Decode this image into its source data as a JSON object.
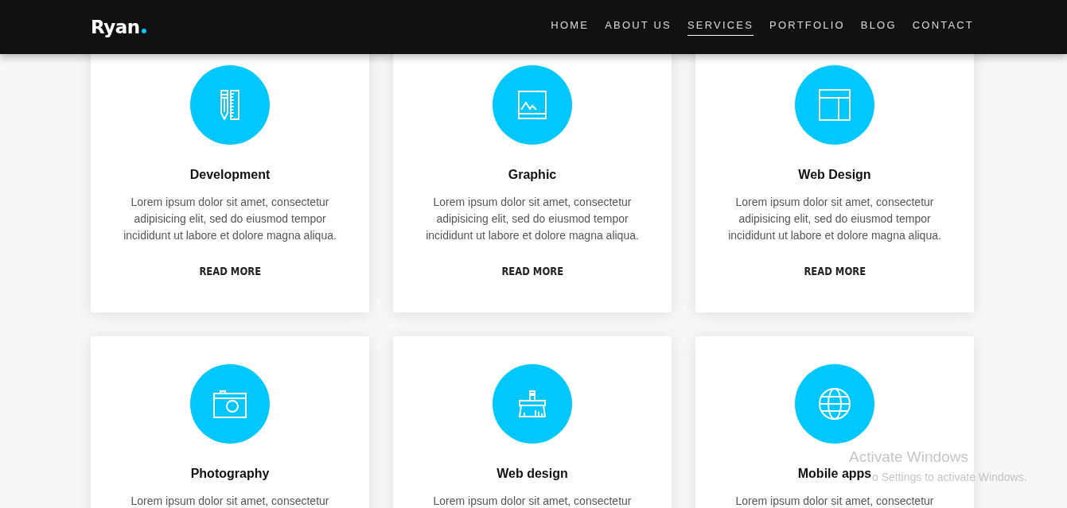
{
  "header": {
    "logo": "Ryan",
    "nav": [
      {
        "label": "HOME",
        "selected": false
      },
      {
        "label": "ABOUT US",
        "selected": false
      },
      {
        "label": "SERVICES",
        "selected": true
      },
      {
        "label": "PORTFOLIO",
        "selected": false
      },
      {
        "label": "BLOG",
        "selected": false
      },
      {
        "label": "CONTACT",
        "selected": false
      }
    ]
  },
  "services": [
    {
      "kind": "development",
      "title": "Development",
      "text": "Lorem ipsum dolor sit amet, consectetur adipisicing elit, sed do eiusmod tempor incididunt ut labore et dolore magna aliqua.",
      "link": "READ MORE"
    },
    {
      "kind": "graphic",
      "title": "Graphic",
      "text": "Lorem ipsum dolor sit amet, consectetur adipisicing elit, sed do eiusmod tempor incididunt ut labore et dolore magna aliqua.",
      "link": "READ MORE"
    },
    {
      "kind": "webdesign",
      "title": "Web Design",
      "text": "Lorem ipsum dolor sit amet, consectetur adipisicing elit, sed do eiusmod tempor incididunt ut labore et dolore magna aliqua.",
      "link": "READ MORE"
    },
    {
      "kind": "photography",
      "title": "Photography",
      "text": "Lorem ipsum dolor sit amet, consectetur"
    },
    {
      "kind": "cleaning",
      "title": "Web design",
      "text": "Lorem ipsum dolor sit amet, consectetur"
    },
    {
      "kind": "global",
      "title": "Mobile apps",
      "text": "Lorem ipsum dolor sit amet, consectetur"
    }
  ],
  "activation_notice": {
    "title": "Activate Windows",
    "text": "o Settings to activate Windows."
  }
}
